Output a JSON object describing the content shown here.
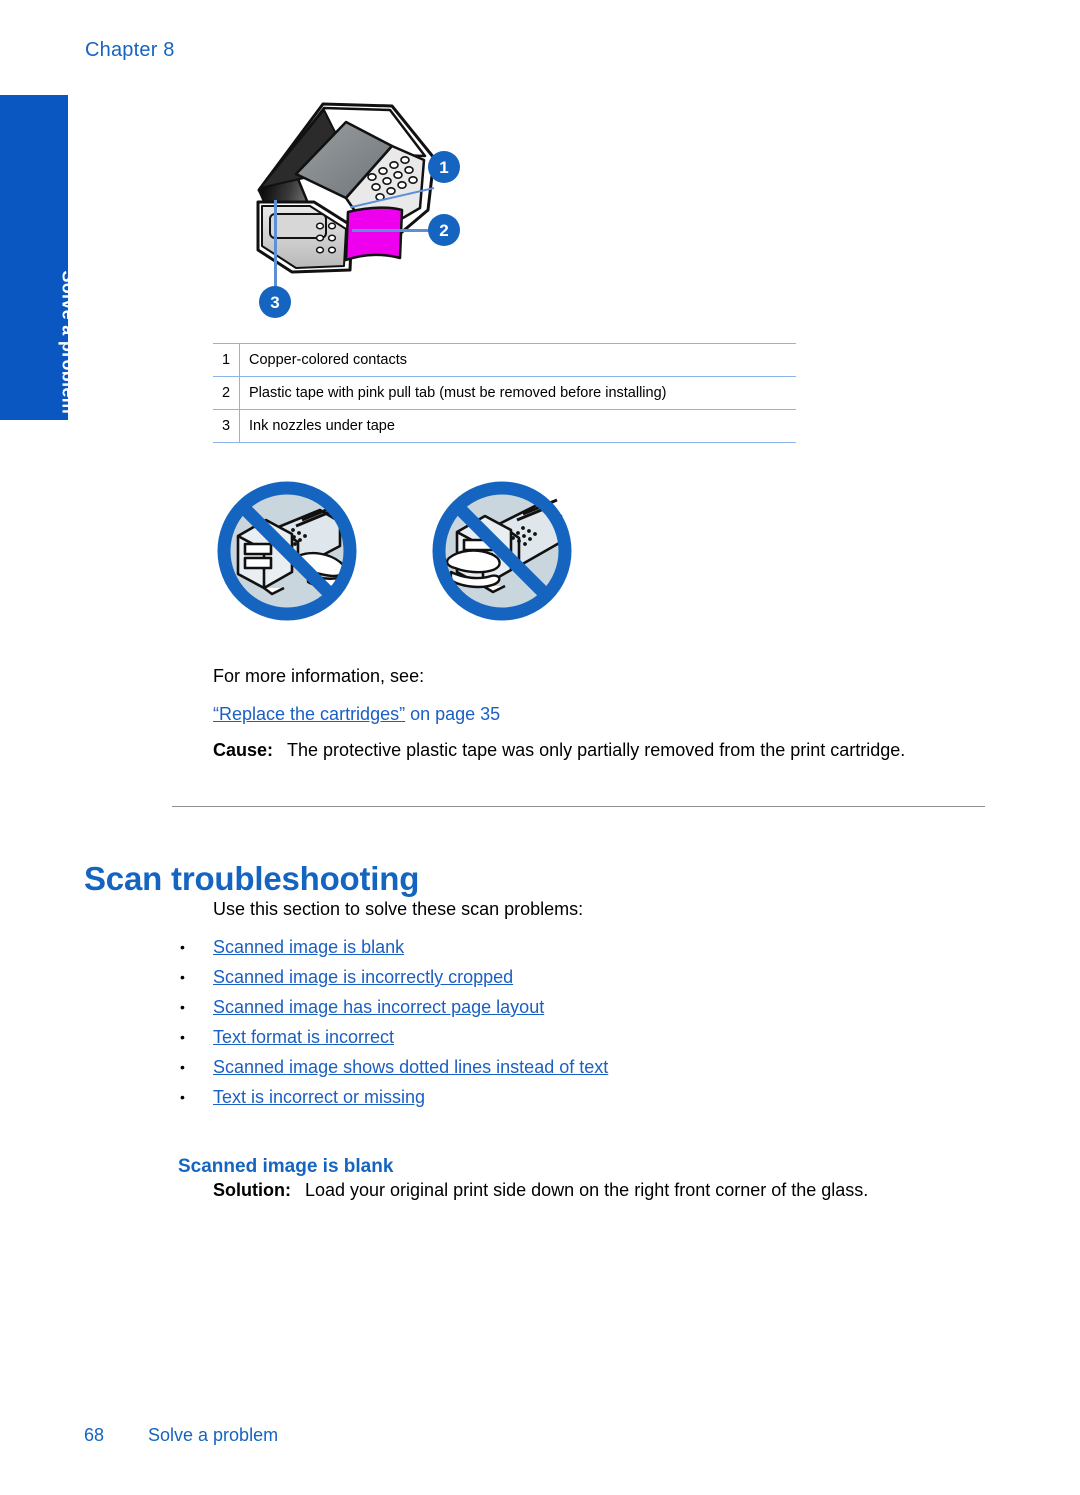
{
  "page": {
    "chapter_label": "Chapter 8",
    "side_tab_label": "Solve a problem",
    "footer_page_number": "68",
    "footer_section_name": "Solve a problem",
    "accent_blue": "#1565C0",
    "tab_blue": "#0A57C2",
    "link_blue": "#1A5FC4",
    "tape_magenta": "#EE00EE",
    "rule_gray": "#8D8D8D",
    "table_rule_blue": "#8CB4E8"
  },
  "figure": {
    "name": "print-cartridge-diagram",
    "callouts": [
      {
        "number": "1"
      },
      {
        "number": "2"
      },
      {
        "number": "3"
      }
    ],
    "legend": {
      "rows": [
        {
          "num": "1",
          "text": "Copper-colored contacts"
        },
        {
          "num": "2",
          "text": "Plastic tape with pink pull tab (must be removed before installing)"
        },
        {
          "num": "3",
          "text": "Ink nozzles under tape"
        }
      ]
    },
    "prohibitions": [
      {
        "name": "do-not-touch-contacts-icon"
      },
      {
        "name": "do-not-touch-nozzles-icon"
      }
    ]
  },
  "cartridge_section": {
    "more_info_text": "For more information, see:",
    "cross_reference": {
      "link_text": "“Replace the cartridges”",
      "suffix": " on page 35"
    },
    "cause": {
      "label": "Cause:",
      "text": "The protective plastic tape was only partially removed from the print cartridge."
    }
  },
  "scan_section": {
    "heading": "Scan troubleshooting",
    "intro": "Use this section to solve these scan problems:",
    "bullet": "•",
    "links": [
      "Scanned image is blank",
      "Scanned image is incorrectly cropped",
      "Scanned image has incorrect page layout",
      "Text format is incorrect",
      "Scanned image shows dotted lines instead of text",
      "Text is incorrect or missing"
    ],
    "subsection": {
      "heading": "Scanned image is blank",
      "solution": {
        "label": "Solution:",
        "text": "Load your original print side down on the right front corner of the glass."
      }
    }
  }
}
